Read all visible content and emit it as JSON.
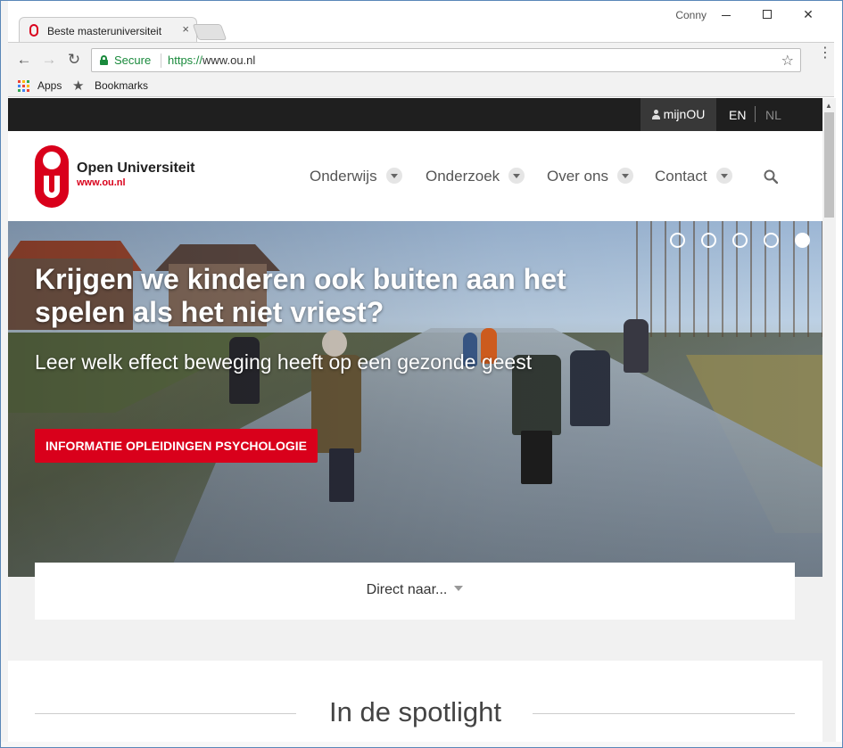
{
  "browser": {
    "tab_title": "Beste masteruniversiteit",
    "tab_close": "×",
    "user": "Conny",
    "window_controls": {
      "close": "✕"
    },
    "nav": {
      "back": "←",
      "forward": "→",
      "reload": "↻"
    },
    "security_label": "Secure",
    "url_scheme": "https://",
    "url_host": "www.ou.nl",
    "star": "☆",
    "menu": "⋮",
    "bookmarks": {
      "apps": "Apps",
      "star": "★",
      "bookmarks": "Bookmarks"
    }
  },
  "site": {
    "topbar": {
      "mijnou": "mijnOU",
      "lang_en": "EN",
      "lang_nl": "NL"
    },
    "logo": {
      "name": "Open Universiteit",
      "url": "www.ou.nl"
    },
    "nav": [
      "Onderwijs",
      "Onderzoek",
      "Over ons",
      "Contact"
    ],
    "hero": {
      "title": "Krijgen we kinderen ook buiten aan het spelen als het niet vriest?",
      "subtitle": "Leer welk effect beweging heeft op een gezonde geest",
      "cta": "INFORMATIE OPLEIDINGEN PSYCHOLOGIE",
      "slides_total": 5,
      "active_slide": 5
    },
    "direct": "Direct naar...",
    "spotlight": "In de spotlight"
  },
  "colors": {
    "brand_red": "#d9001b",
    "topbar_bg": "#1f1f1f",
    "secure_green": "#1a8a3c"
  }
}
